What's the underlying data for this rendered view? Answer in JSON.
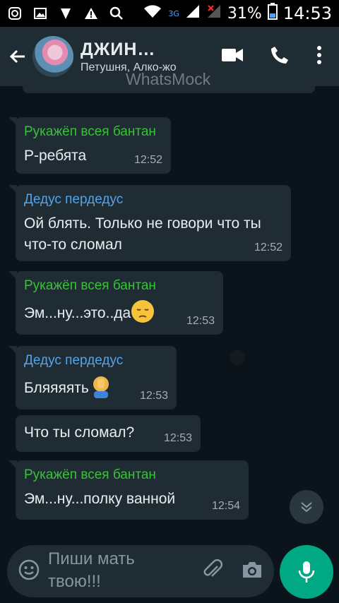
{
  "status_bar": {
    "network": "3G",
    "battery": "31%",
    "time": "14:53"
  },
  "header": {
    "title": "ДЖИН…",
    "subtitle": "Петушня, Алко-жо",
    "watermark": "WhatsMock"
  },
  "colors": {
    "green_sender": "#3bc03b",
    "blue_sender": "#55a3e8",
    "accent": "#00a884"
  },
  "messages": [
    {
      "sender": "Рукажёп всея бантан",
      "text": "Р-ребята",
      "time": "12:52"
    },
    {
      "sender": "Дедус пердедус",
      "text": "Ой блять. Только не говори что ты что-то сломал",
      "time": "12:52"
    },
    {
      "sender": "Рукажёп всея бантан",
      "text": "Эм...ну...это..да",
      "emoji": "pensive-face",
      "time": "12:53"
    },
    {
      "sender": "Дедус пердедус",
      "text": "Бляяяять",
      "emoji": "facepalm",
      "time": "12:53"
    },
    {
      "sender": "",
      "text": "Что ты сломал?",
      "time": "12:53"
    },
    {
      "sender": "Рукажёп всея бантан",
      "text": "Эм...ну...полку ванной",
      "time": "12:54"
    }
  ],
  "input": {
    "placeholder": "Пиши мать твою!!!"
  }
}
